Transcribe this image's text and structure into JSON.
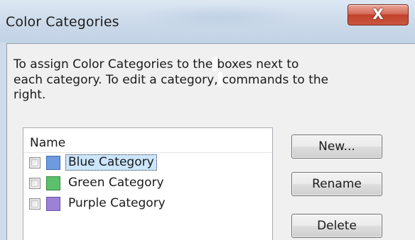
{
  "window": {
    "title": "Color Categories",
    "close_glyph": "X"
  },
  "description": {
    "line1_a": "To assign Color Categories to the",
    "line1_b": "boxes next to",
    "line2_a": "each category.  To edit a category,",
    "line2_b": "commands to the",
    "line3": "right."
  },
  "list": {
    "header": "Name",
    "items": [
      {
        "label": "Blue Category",
        "color": "#6e9be0",
        "border": "#3f6cb0",
        "selected": true
      },
      {
        "label": "Green Category",
        "color": "#5dc06a",
        "border": "#2f8a3c",
        "selected": false
      },
      {
        "label": "Purple Category",
        "color": "#9b82d6",
        "border": "#6a51a8",
        "selected": false
      }
    ]
  },
  "buttons": {
    "new": "New...",
    "rename": "Rename",
    "delete": "Delete"
  }
}
